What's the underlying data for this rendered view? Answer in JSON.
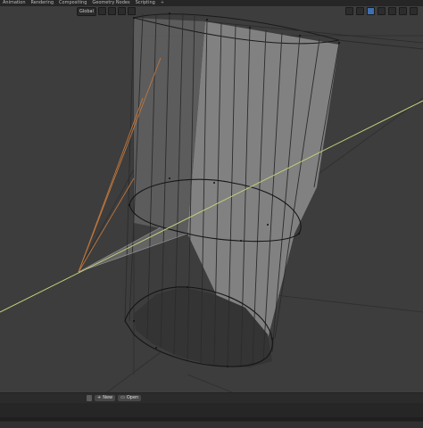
{
  "topbar": {
    "tabs": [
      "Animation",
      "Rendering",
      "Compositing",
      "Geometry Nodes",
      "Scripting"
    ],
    "more": "+"
  },
  "viewport_header": {
    "orientation": "Global"
  },
  "timeline": {
    "new_label": "New",
    "open_label": "Open"
  },
  "colors": {
    "viewport_bg": "#3d3d3d",
    "mesh_face": "#8a8a8a",
    "edge": "#111111",
    "light_ray": "#c8d57a",
    "camera_line": "#c0773d"
  }
}
